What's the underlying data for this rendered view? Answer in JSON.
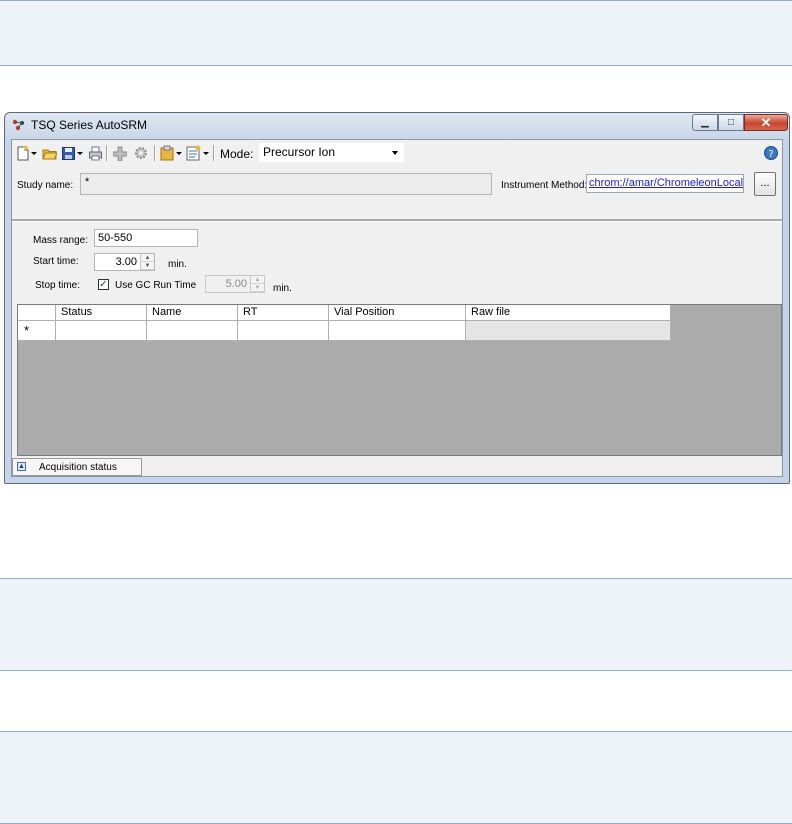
{
  "window": {
    "title": "TSQ Series AutoSRM"
  },
  "toolbar": {
    "icons": [
      "new-icon",
      "open-icon",
      "save-icon",
      "print-icon",
      "add-icon",
      "settings-icon",
      "clipboard-icon",
      "properties-icon",
      "help-icon"
    ],
    "mode_label": "Mode:",
    "mode_value": "Precursor Ion"
  },
  "study": {
    "label": "Study name:",
    "value": "*"
  },
  "instrument_method": {
    "label": "Instrument Method:",
    "value": "chrom://amar/ChromeleonLocal/TS",
    "browse_label": "..."
  },
  "mass_range": {
    "label": "Mass range:",
    "value": "50-550"
  },
  "start_time": {
    "label": "Start time:",
    "value": "3.00",
    "unit": "min."
  },
  "stop_time": {
    "label": "Stop time:",
    "use_gc_label": "Use GC Run Time",
    "use_gc_checked": true,
    "value": "5.00",
    "unit": "min."
  },
  "grid": {
    "columns": [
      "Status",
      "Name",
      "RT",
      "Vial Position",
      "Raw file"
    ],
    "new_row_marker": "*"
  },
  "status_panel": {
    "label": "Acquisition status"
  }
}
